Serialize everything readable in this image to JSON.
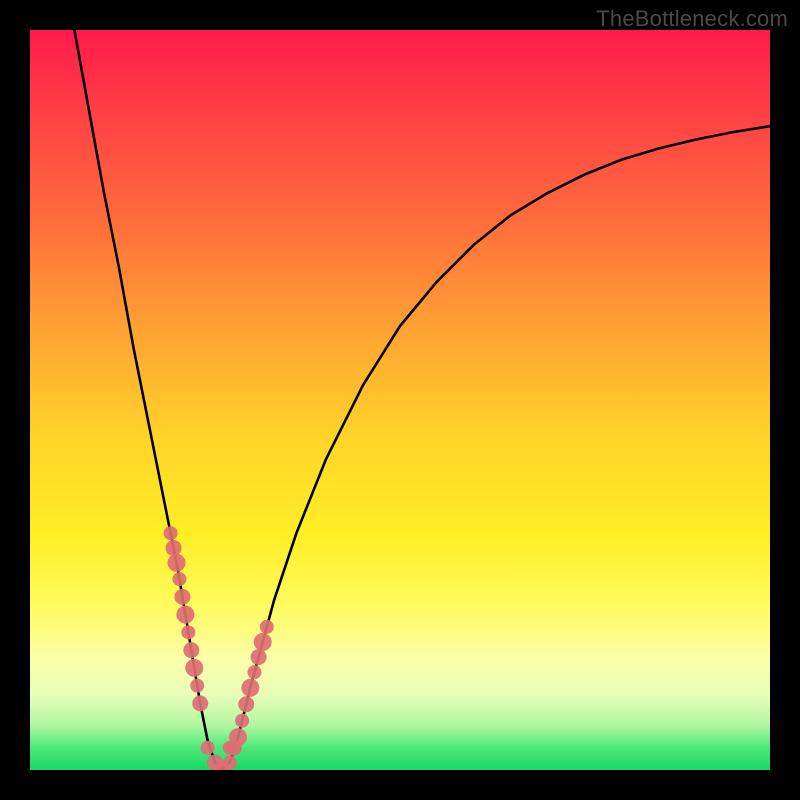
{
  "watermark": "TheBottleneck.com",
  "chart_data": {
    "type": "line",
    "title": "",
    "xlabel": "",
    "ylabel": "",
    "xlim": [
      0,
      100
    ],
    "ylim": [
      0,
      100
    ],
    "grid": false,
    "legend": "none",
    "series": [
      {
        "name": "bottleneck-curve",
        "x": [
          6,
          8,
          10,
          12,
          14,
          16,
          18,
          20,
          22,
          23,
          24,
          25,
          26,
          27,
          28,
          30,
          33,
          36,
          40,
          45,
          50,
          55,
          60,
          65,
          70,
          75,
          80,
          85,
          90,
          95,
          100
        ],
        "y": [
          100,
          89,
          78,
          68,
          57,
          47,
          37,
          27,
          15,
          9,
          4,
          1,
          0,
          1,
          4,
          12,
          23,
          32,
          42,
          52,
          60,
          66,
          71,
          75,
          78,
          80.5,
          82.5,
          84,
          85.2,
          86.2,
          87
        ]
      }
    ],
    "marker_clusters": [
      {
        "name": "left-arm-dots",
        "x_range": [
          19,
          23
        ],
        "y_range": [
          8,
          32
        ],
        "count": 11
      },
      {
        "name": "right-arm-dots",
        "x_range": [
          27,
          32
        ],
        "y_range": [
          3,
          27
        ],
        "count": 10
      },
      {
        "name": "valley-dots",
        "x_range": [
          24,
          27
        ],
        "y_range": [
          0,
          3
        ],
        "count": 4
      }
    ],
    "colors": {
      "curve": "#000000",
      "markers": "#de6e72",
      "frame": "#000000"
    }
  }
}
